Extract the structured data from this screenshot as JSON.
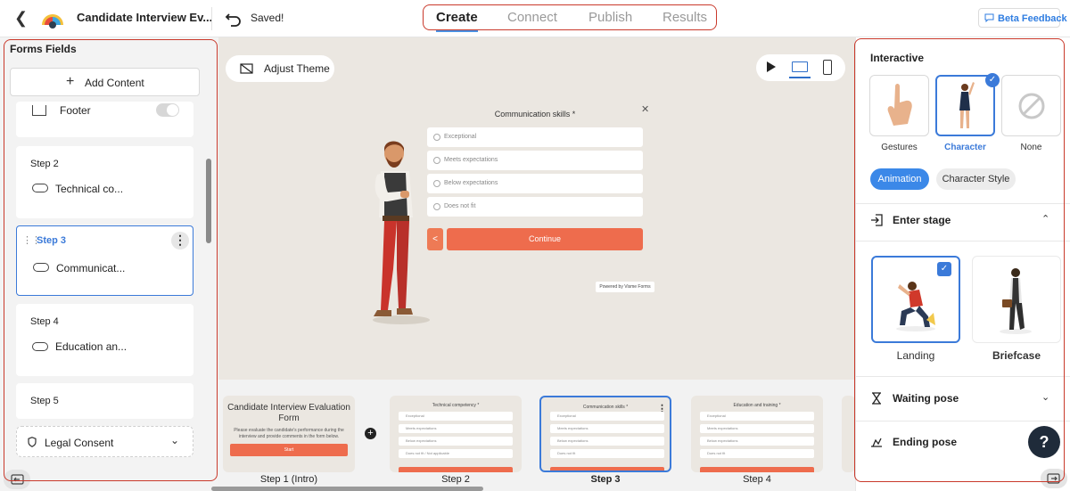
{
  "topbar": {
    "title": "Candidate Interview Ev...",
    "saved": "Saved!",
    "tabs": [
      {
        "label": "Create",
        "active": true
      },
      {
        "label": "Connect",
        "active": false
      },
      {
        "label": "Publish",
        "active": false
      },
      {
        "label": "Results",
        "active": false
      }
    ],
    "beta_feedback": "Beta Feedback"
  },
  "left_panel": {
    "title": "Forms Fields",
    "add_content": "Add Content",
    "footer": {
      "label": "Footer",
      "toggle_on": false
    },
    "steps": [
      {
        "step": "Step 2",
        "field": "Technical co...",
        "selected": false
      },
      {
        "step": "Step 3",
        "field": "Communicat...",
        "selected": true
      },
      {
        "step": "Step 4",
        "field": "Education an...",
        "selected": false
      },
      {
        "step": "Step 5",
        "field": "",
        "selected": false
      }
    ],
    "legal_consent": "Legal Consent"
  },
  "canvas": {
    "adjust_theme": "Adjust Theme",
    "form": {
      "question": "Communication skills *",
      "options": [
        "Exceptional",
        "Meets expectations",
        "Below expectations",
        "Does not fit"
      ],
      "back": "<",
      "continue": "Continue",
      "powered_by": "Powered by Visme Forms"
    }
  },
  "thumbnails": [
    {
      "label": "Step 1 (Intro)",
      "intro_title": "Candidate Interview Evaluation Form",
      "intro_desc": "Please evaluate the candidate's performance during the interview and provide comments in the form below.",
      "intro_start": "Start",
      "selected": false
    },
    {
      "label": "Step 2",
      "title": "Technical competency *",
      "rows": [
        "Exceptional",
        "Meets expectations",
        "Below expectations",
        "Does not fit / Not applicable"
      ],
      "selected": false
    },
    {
      "label": "Step 3",
      "title": "Communication skills *",
      "rows": [
        "Exceptional",
        "Meets expectations",
        "Below expectations",
        "Does not fit"
      ],
      "selected": true
    },
    {
      "label": "Step 4",
      "title": "Education and training *",
      "rows": [
        "Exceptional",
        "Meets expectations",
        "Below expectations",
        "Does not fit"
      ],
      "selected": false
    }
  ],
  "right_panel": {
    "title": "Interactive",
    "types": [
      {
        "label": "Gestures",
        "selected": false
      },
      {
        "label": "Character",
        "selected": true
      },
      {
        "label": "None",
        "selected": false
      }
    ],
    "tabs": [
      {
        "label": "Animation",
        "active": true
      },
      {
        "label": "Character Style",
        "active": false
      }
    ],
    "enter_stage": "Enter stage",
    "poses": [
      {
        "label": "Landing",
        "selected": true
      },
      {
        "label": "Briefcase",
        "selected": false
      }
    ],
    "waiting_pose": "Waiting pose",
    "ending_pose": "Ending pose",
    "help": "?"
  },
  "colors": {
    "accent": "#3b7ad9",
    "cta": "#ee6c4d",
    "highlight_outline": "#c9392b",
    "canvas_bg": "#ebe7e1"
  }
}
